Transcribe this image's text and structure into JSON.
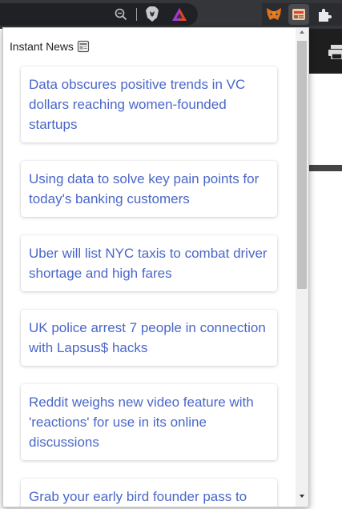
{
  "popup": {
    "title": "Instant News",
    "title_icon": "newspaper-icon",
    "news_items": [
      "Data obscures positive trends in VC dollars reaching women-founded startups",
      "Using data to solve key pain points for today's banking customers",
      "Uber will list NYC taxis to combat driver shortage and high fares",
      "UK police arrest 7 people in connection with Lapsus$ hacks",
      "Reddit weighs new video feature with 'reactions' for use in its online discussions",
      "Grab your early bird founder pass to"
    ]
  },
  "toolbar": {
    "icons": [
      "zoom-icon",
      "brave-shields-icon",
      "brave-rewards-icon",
      "metamask-icon",
      "instant-news-extension-icon",
      "extensions-puzzle-icon"
    ]
  },
  "colors": {
    "headline": "#4a67c9",
    "toolbar_bg": "#35363a",
    "omnibox_bg": "#202124"
  }
}
